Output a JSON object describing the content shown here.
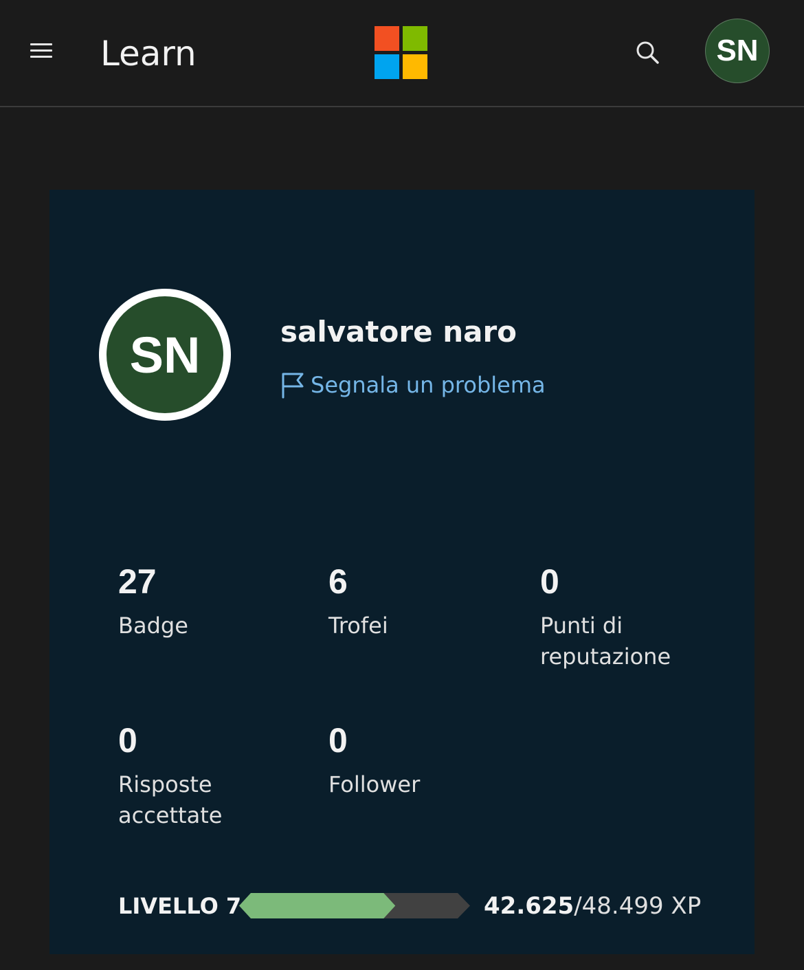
{
  "header": {
    "title": "Learn",
    "avatar_initials": "SN",
    "icons": {
      "menu": "hamburger-menu-icon",
      "logo": "microsoft-logo",
      "search": "search-icon"
    }
  },
  "profile": {
    "avatar_initials": "SN",
    "name": "salvatore naro",
    "report_link": "Segnala un problema",
    "report_icon": "flag-icon"
  },
  "stats": [
    {
      "value": "27",
      "label": "Badge"
    },
    {
      "value": "6",
      "label": "Trofei"
    },
    {
      "value": "0",
      "label": "Punti di reputazione"
    },
    {
      "value": "0",
      "label": "Risposte accettate"
    },
    {
      "value": "0",
      "label": "Follower"
    }
  ],
  "level": {
    "label": "LIVELLO 7",
    "xp_current": "42.625",
    "xp_total": "/48.499 XP",
    "progress_fraction": 0.64
  },
  "colors": {
    "background": "#1b1b1b",
    "card": "#0a1e2b",
    "avatar": "#264d2b",
    "link": "#75b6e7",
    "progress_fill": "#7cba7a",
    "progress_track": "#414141",
    "ms_red": "#f25022",
    "ms_green": "#7fba00",
    "ms_blue": "#00a4ef",
    "ms_yellow": "#ffb900"
  }
}
